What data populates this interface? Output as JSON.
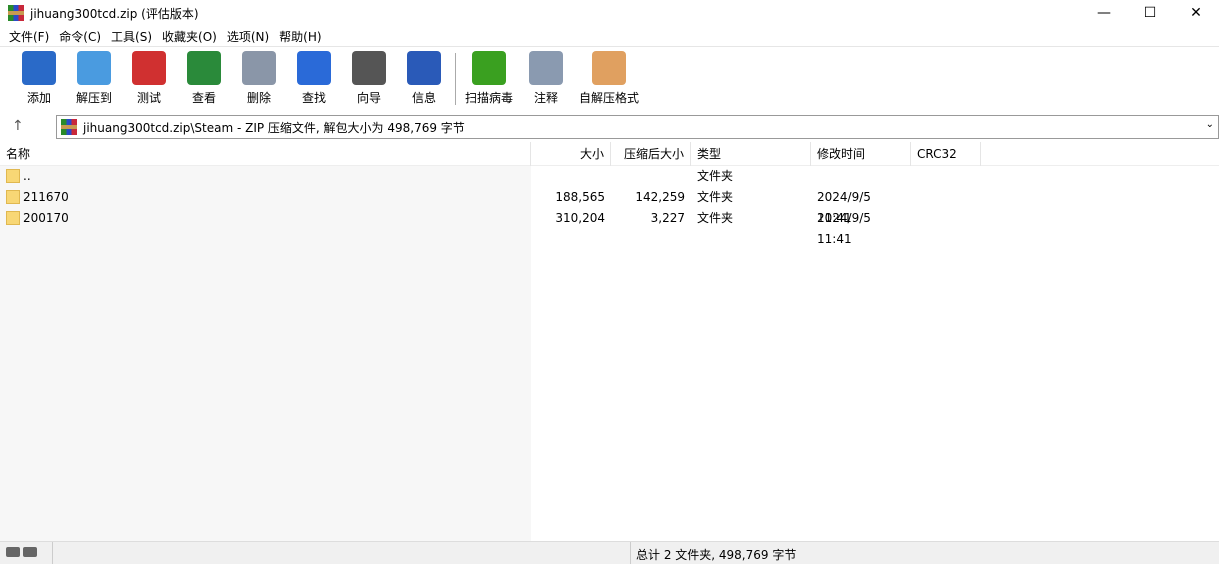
{
  "window": {
    "title": "jihuang300tcd.zip (评估版本)",
    "minimize": "—",
    "maximize": "☐",
    "close": "✕"
  },
  "menu": [
    "文件(F)",
    "命令(C)",
    "工具(S)",
    "收藏夹(O)",
    "选项(N)",
    "帮助(H)"
  ],
  "toolbar": [
    {
      "label": "添加",
      "icon": "add-archive-icon",
      "color": "#2a6ac8"
    },
    {
      "label": "解压到",
      "icon": "extract-folder-icon",
      "color": "#4a9be0"
    },
    {
      "label": "测试",
      "icon": "test-clipboard-icon",
      "color": "#d03030"
    },
    {
      "label": "查看",
      "icon": "view-book-icon",
      "color": "#2a8a3a"
    },
    {
      "label": "删除",
      "icon": "trash-icon",
      "color": "#8a96a8"
    },
    {
      "label": "查找",
      "icon": "magnifier-icon",
      "color": "#2a6ad8"
    },
    {
      "label": "向导",
      "icon": "wizard-wand-icon",
      "color": "#555555"
    },
    {
      "label": "信息",
      "icon": "info-icon",
      "color": "#2a5ab8"
    },
    {
      "label": "扫描病毒",
      "icon": "virus-scan-icon",
      "color": "#3aa020"
    },
    {
      "label": "注释",
      "icon": "comment-icon",
      "color": "#8a9ab0"
    },
    {
      "label": "自解压格式",
      "icon": "sfx-box-icon",
      "color": "#e0a060"
    }
  ],
  "address": {
    "up": "↑",
    "path": "jihuang300tcd.zip\\Steam - ZIP 压缩文件, 解包大小为 498,769 字节",
    "dropdown": "⌄"
  },
  "columns": {
    "name": "名称",
    "size": "大小",
    "packed": "压缩后大小",
    "type": "类型",
    "modified": "修改时间",
    "crc": "CRC32"
  },
  "rows": [
    {
      "name": "..",
      "size": "",
      "packed": "",
      "type": "文件夹",
      "modified": ""
    },
    {
      "name": "211670",
      "size": "188,565",
      "packed": "142,259",
      "type": "文件夹",
      "modified": "2024/9/5 11:41"
    },
    {
      "name": "200170",
      "size": "310,204",
      "packed": "3,227",
      "type": "文件夹",
      "modified": "2024/9/5 11:41"
    }
  ],
  "status": {
    "summary": "总计 2 文件夹, 498,769 字节"
  }
}
